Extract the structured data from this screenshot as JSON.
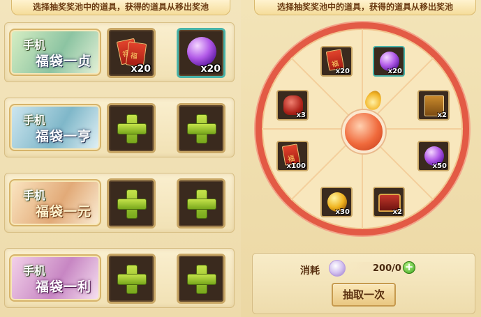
{
  "hints": {
    "left": "选择抽奖奖池中的道具，获得的道具从移出奖池",
    "right": "选择抽奖奖池中的道具，获得的道具从移出奖池"
  },
  "bags": [
    {
      "line1": "手机",
      "line2": "福袋一贞",
      "slots": [
        {
          "item": "red-envelope",
          "qty": "x20"
        },
        {
          "item": "purple-orb",
          "qty": "x20"
        }
      ]
    },
    {
      "line1": "手机",
      "line2": "福袋一亨",
      "slots": [
        {
          "item": "empty-plus",
          "qty": ""
        },
        {
          "item": "empty-plus",
          "qty": ""
        }
      ]
    },
    {
      "line1": "手机",
      "line2": "福袋一元",
      "slots": [
        {
          "item": "empty-plus",
          "qty": ""
        },
        {
          "item": "empty-plus",
          "qty": ""
        }
      ]
    },
    {
      "line1": "手机",
      "line2": "福袋一利",
      "slots": [
        {
          "item": "empty-plus",
          "qty": ""
        },
        {
          "item": "empty-plus",
          "qty": ""
        }
      ]
    }
  ],
  "wheel": {
    "items": [
      {
        "item": "red-envelope",
        "qty": "x20"
      },
      {
        "item": "purple-orb",
        "qty": "x20"
      },
      {
        "item": "scroll-card",
        "qty": "x2"
      },
      {
        "item": "purple-orb",
        "qty": "x50"
      },
      {
        "item": "treasure-chest",
        "qty": "x2"
      },
      {
        "item": "gold-coin",
        "qty": "x30"
      },
      {
        "item": "red-envelope",
        "qty": "x100"
      },
      {
        "item": "red-gift-bag",
        "qty": "x3"
      }
    ],
    "wheel_color": "#e35a45"
  },
  "cost": {
    "label": "消耗",
    "value": "200/0",
    "add": "+"
  },
  "draw_button": "抽取一次"
}
